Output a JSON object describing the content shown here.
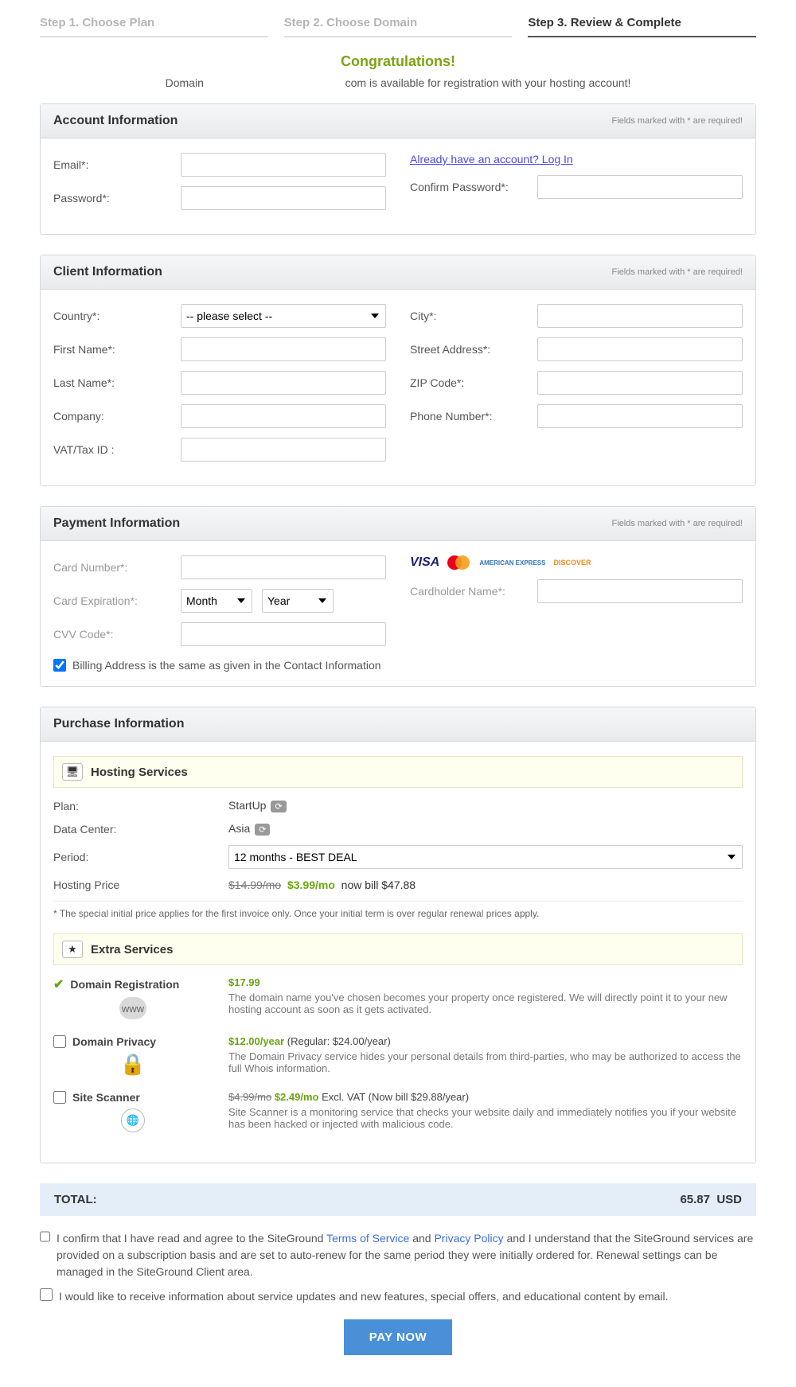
{
  "steps": {
    "s1": "Step 1. Choose Plan",
    "s2": "Step 2. Choose Domain",
    "s3": "Step 3. Review & Complete"
  },
  "hero": {
    "congrats": "Congratulations!",
    "prefix": "Domain",
    "suffix": "com is available for registration with your hosting account!"
  },
  "req_note": "Fields marked with * are required!",
  "account": {
    "title": "Account Information",
    "email": "Email*:",
    "password": "Password*:",
    "login_link": "Already have an account? Log In",
    "confirm": "Confirm Password*:"
  },
  "client": {
    "title": "Client Information",
    "country": "Country*:",
    "country_ph": "-- please select --",
    "first": "First Name*:",
    "last": "Last Name*:",
    "company": "Company:",
    "vat": "VAT/Tax ID :",
    "city": "City*:",
    "street": "Street Address*:",
    "zip": "ZIP Code*:",
    "phone": "Phone Number*:"
  },
  "payment": {
    "title": "Payment Information",
    "card_num": "Card Number*:",
    "card_exp": "Card Expiration*:",
    "month_ph": "Month",
    "year_ph": "Year",
    "holder": "Cardholder Name*:",
    "cvv": "CVV Code*:",
    "billing_same": "Billing Address is the same as given in the Contact Information",
    "cards": {
      "visa": "VISA",
      "amex": "AMERICAN EXPRESS",
      "disc": "DISCOVER"
    }
  },
  "purchase": {
    "title": "Purchase Information",
    "hosting_band": "Hosting Services",
    "plan_l": "Plan:",
    "plan_v": "StartUp",
    "dc_l": "Data Center:",
    "dc_v": "Asia",
    "period_l": "Period:",
    "period_v": "12 months - BEST DEAL",
    "price_l": "Hosting Price",
    "price_strike": "$14.99/mo",
    "price_now": "$3.99/mo",
    "price_bill": "now bill $47.88",
    "footnote": "* The special initial price applies for the first invoice only. Once your initial term is over regular renewal prices apply.",
    "extra_band": "Extra Services",
    "svc1": {
      "title": "Domain Registration",
      "price": "$17.99",
      "desc": "The domain name you've chosen becomes your property once registered. We will directly point it to your new hosting account as soon as it gets activated."
    },
    "svc2": {
      "title": "Domain Privacy",
      "price": "$12.00/year",
      "reg": "(Regular: $24.00/year)",
      "desc": "The Domain Privacy service hides your personal details from third-parties, who may be authorized to access the full Whois information."
    },
    "svc3": {
      "title": "Site Scanner",
      "price_strike": "$4.99/mo",
      "price": "$2.49/mo",
      "excl": "Excl. VAT (Now bill $29.88/year)",
      "desc": "Site Scanner is a monitoring service that checks your website daily and immediately notifies you if your website has been hacked or injected with malicious code."
    }
  },
  "total": {
    "label": "TOTAL:",
    "amount": "65.87",
    "currency": "USD"
  },
  "confirm1": {
    "pre": "I confirm that I have read and agree to the SiteGround ",
    "tos": "Terms of Service",
    "and": " and ",
    "pp": "Privacy Policy",
    "post": " and I understand that the SiteGround services are provided on a subscription basis and are set to auto-renew for the same period they were initially ordered for. Renewal settings can be managed in the SiteGround Client area."
  },
  "confirm2": "I would like to receive information about service updates and new features, special offers, and educational content by email.",
  "pay": "PAY NOW"
}
